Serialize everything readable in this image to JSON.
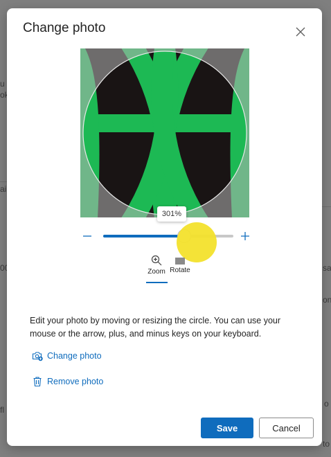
{
  "dialog": {
    "title": "Change photo",
    "close_icon": "close-icon",
    "zoom_value": "301%",
    "zoom_level_fraction": 0.62,
    "tools": [
      {
        "label": "Zoom",
        "icon": "zoom-in-icon",
        "selected": true
      },
      {
        "label": "Rotate",
        "icon": "rotate-icon",
        "selected": false
      }
    ],
    "description": "Edit your photo by moving or resizing the circle. You can use your mouse or the arrow, plus, and minus keys on your keyboard.",
    "change_photo_link": "Change photo",
    "remove_photo_link": "Remove photo",
    "save_label": "Save",
    "cancel_label": "Cancel"
  },
  "background": {
    "fragments": [
      "u",
      "ok",
      "ai",
      "00",
      "fl",
      "sa",
      "on",
      "o",
      "to"
    ]
  },
  "colors": {
    "accent": "#0f6cbd",
    "photo_green": "#1db954",
    "photo_black": "#191414",
    "overlay_gray": "#8f8f8f",
    "highlight_yellow": "#f3e22c"
  }
}
